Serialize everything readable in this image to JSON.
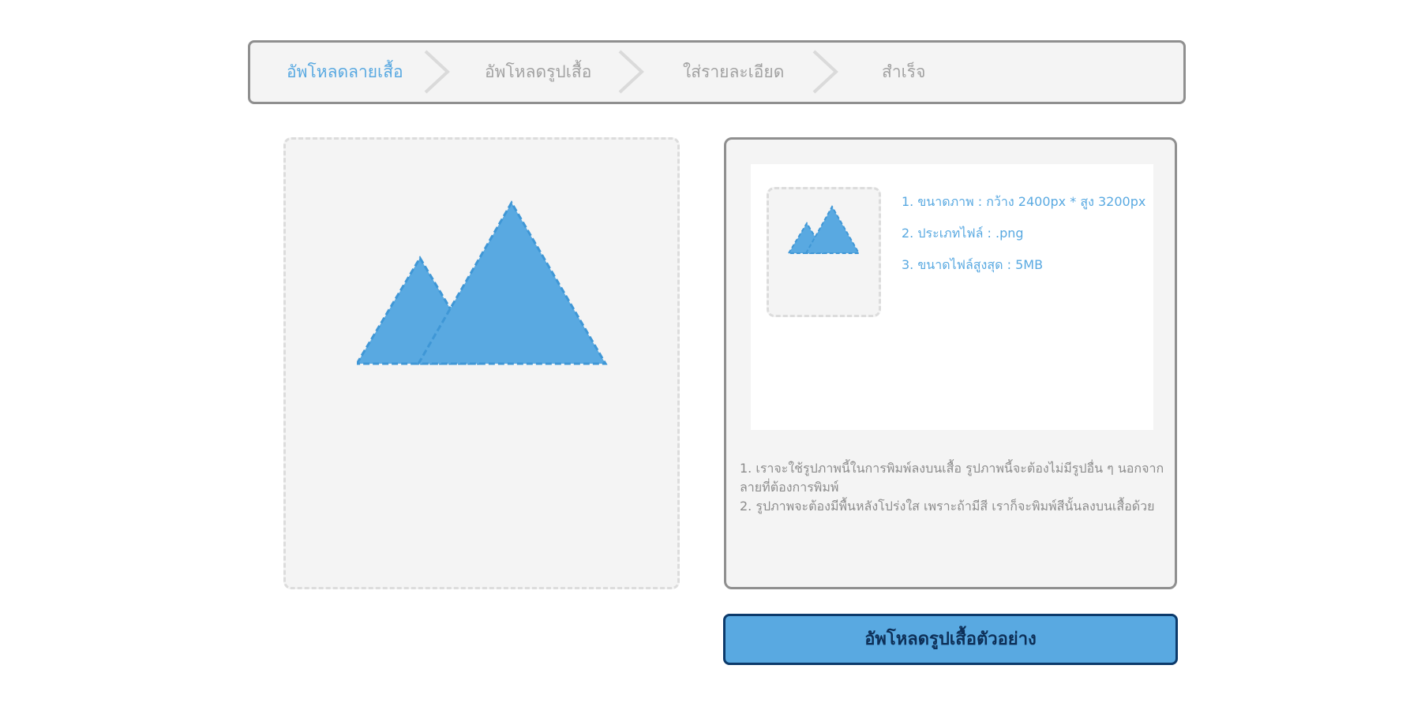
{
  "steps": [
    {
      "label": "อัพโหลดลายเสื้อ",
      "active": true
    },
    {
      "label": "อัพโหลดรูปเสื้อ",
      "active": false
    },
    {
      "label": "ใส่รายละเอียด",
      "active": false
    },
    {
      "label": "สำเร็จ",
      "active": false
    }
  ],
  "upload_area": {
    "icon": "image-placeholder-icon"
  },
  "requirements": {
    "thumbnail_icon": "image-placeholder-icon",
    "items": [
      "1. ขนาดภาพ : กว้าง 2400px * สูง 3200px",
      "2. ประเภทไฟล์ : .png",
      "3. ขนาดไฟล์สูงสุด : 5MB"
    ]
  },
  "notes": [
    "1. เราจะใช้รูปภาพนี้ในการพิมพ์ลงบนเสื้อ รูปภาพนี้จะต้องไม่มีรูปอื่น ๆ นอกจากลายที่ต้องการพิมพ์",
    "2. รูปภาพจะต้องมีพื้นหลังโปร่งใส เพราะถ้ามีสี เราก็จะพิมพ์สีนั้นลงบนเสื้อด้วย"
  ],
  "upload_button": {
    "label": "อัพโหลดรูปเสื้อตัวอย่าง"
  },
  "colors": {
    "accent": "#59a9e1",
    "inactive_text": "#a2a2a2",
    "panel_border": "#8f8f8f",
    "button_border": "#0c3a6b"
  }
}
